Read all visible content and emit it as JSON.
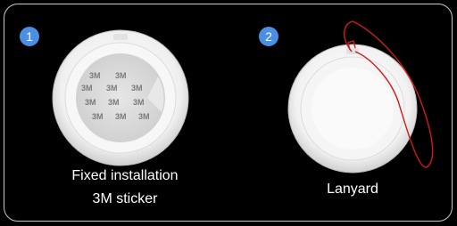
{
  "items": [
    {
      "number": "1",
      "caption_lines": [
        "Fixed installation",
        "3M sticker"
      ]
    },
    {
      "number": "2",
      "caption_lines": [
        "Lanyard"
      ]
    }
  ],
  "sticker_text": "3M",
  "colors": {
    "badge": "#4b8fe2",
    "background": "#000000",
    "border": "#c9c9c9",
    "lanyard": "#d11a1a"
  }
}
